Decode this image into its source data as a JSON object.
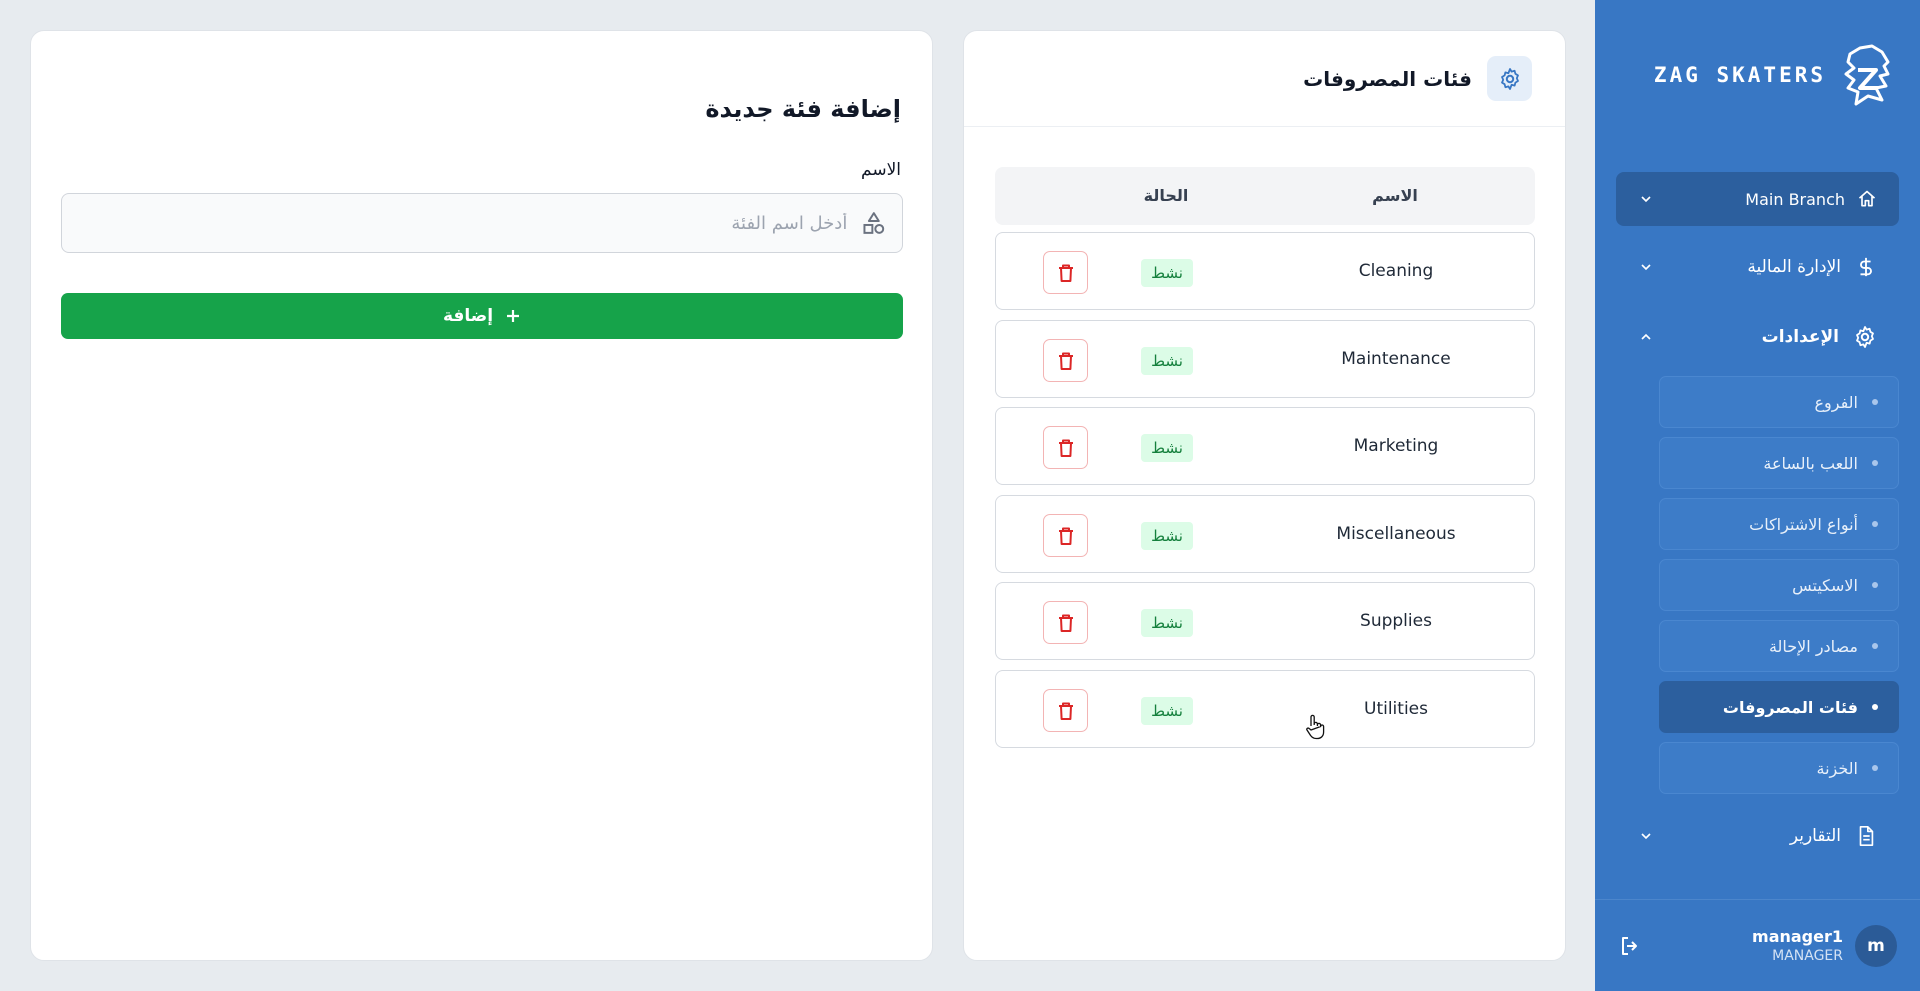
{
  "brand": {
    "name": "ZAG SKATERS"
  },
  "sidebar": {
    "branch_label": "Main Branch",
    "nav": [
      {
        "label": "الإدارة المالية",
        "icon": "dollar-icon"
      },
      {
        "label": "الإعدادات",
        "icon": "gear-icon"
      },
      {
        "label": "التقارير",
        "icon": "document-icon"
      }
    ],
    "settings_items": [
      {
        "label": "الفروع"
      },
      {
        "label": "اللعب بالساعة"
      },
      {
        "label": "أنواع الاشتراكات"
      },
      {
        "label": "الاسكيتس"
      },
      {
        "label": "مصادر الإحالة"
      },
      {
        "label": "فئات المصروفات",
        "active": true
      },
      {
        "label": "الخزنة"
      }
    ]
  },
  "user": {
    "name": "manager1",
    "role": "MANAGER",
    "initial": "m"
  },
  "categories": {
    "title": "فئات المصروفات",
    "columns": {
      "name": "الاسم",
      "status": "الحالة"
    },
    "rows": [
      {
        "name": "Cleaning",
        "status": "نشط"
      },
      {
        "name": "Maintenance",
        "status": "نشط"
      },
      {
        "name": "Marketing",
        "status": "نشط"
      },
      {
        "name": "Miscellaneous",
        "status": "نشط"
      },
      {
        "name": "Supplies",
        "status": "نشط"
      },
      {
        "name": "Utilities",
        "status": "نشط"
      }
    ]
  },
  "form": {
    "title": "إضافة فئة جديدة",
    "name_label": "الاسم",
    "name_placeholder": "أدخل اسم الفئة",
    "name_value": "",
    "submit_label": "إضافة"
  },
  "colors": {
    "sidebar": "#3877c4",
    "sidebar_active": "#2c5f9e",
    "primary_green": "#16a34a",
    "danger_red": "#dc2626",
    "badge_bg": "#dcfce7",
    "badge_text": "#15803d"
  }
}
